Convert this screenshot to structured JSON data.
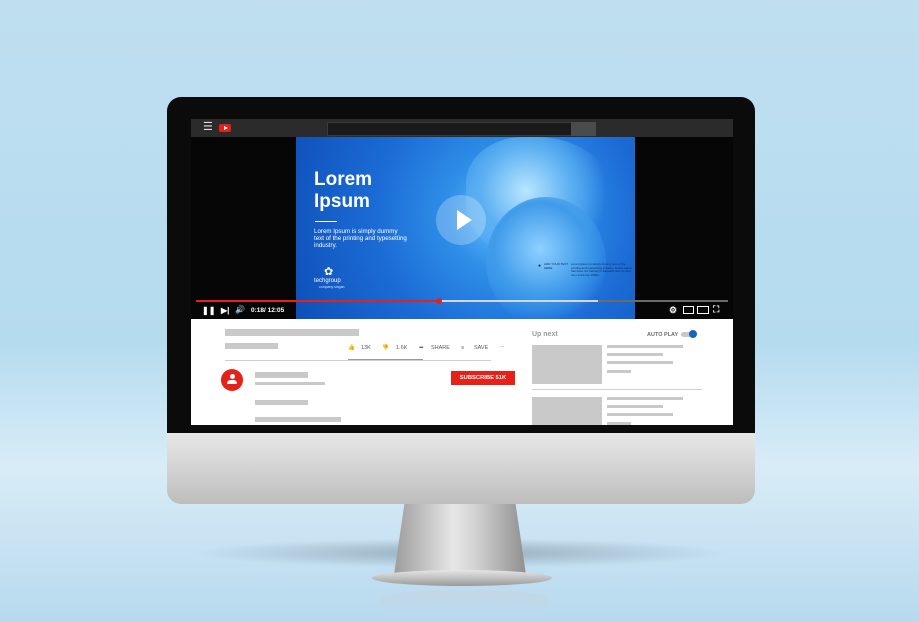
{
  "video": {
    "title": "Lorem Ipsum",
    "body": "Lorem Ipsum is simply dummy text of the printing and typesetting industry.",
    "brand": "techgroup",
    "brand_sub": "company slogan",
    "small_label": "ADD YOUR TEXT HERE",
    "small_text": "Lorem Ipsum is simply dummy text of the printing and typesetting industry. Lorem Ipsum has been the industry's standard dummy text ever since the 1500s."
  },
  "player": {
    "current_time": "0:18",
    "duration": "12:05",
    "time_display": "0:18/ 12:05",
    "played_fraction": 0.457,
    "buffered_fraction": 0.755
  },
  "actions": {
    "likes": "13K",
    "dislikes": "1.6K",
    "share": "SHARE",
    "save": "SAVE",
    "more": "..."
  },
  "channel": {
    "subscribe_label": "SUBSCRIBE 51K"
  },
  "sidebar": {
    "up_next": "Up next",
    "autoplay": "AUTO PLAY"
  },
  "colors": {
    "accent": "#e62117",
    "toggle": "#1565c0"
  },
  "icons": [
    "menu-icon",
    "youtube-logo-icon",
    "play-icon",
    "pause-icon",
    "next-icon",
    "volume-icon",
    "settings-icon",
    "miniplayer-icon",
    "theater-icon",
    "fullscreen-icon",
    "thumbs-up-icon",
    "thumbs-down-icon",
    "share-icon",
    "save-icon",
    "more-icon",
    "avatar-icon"
  ]
}
